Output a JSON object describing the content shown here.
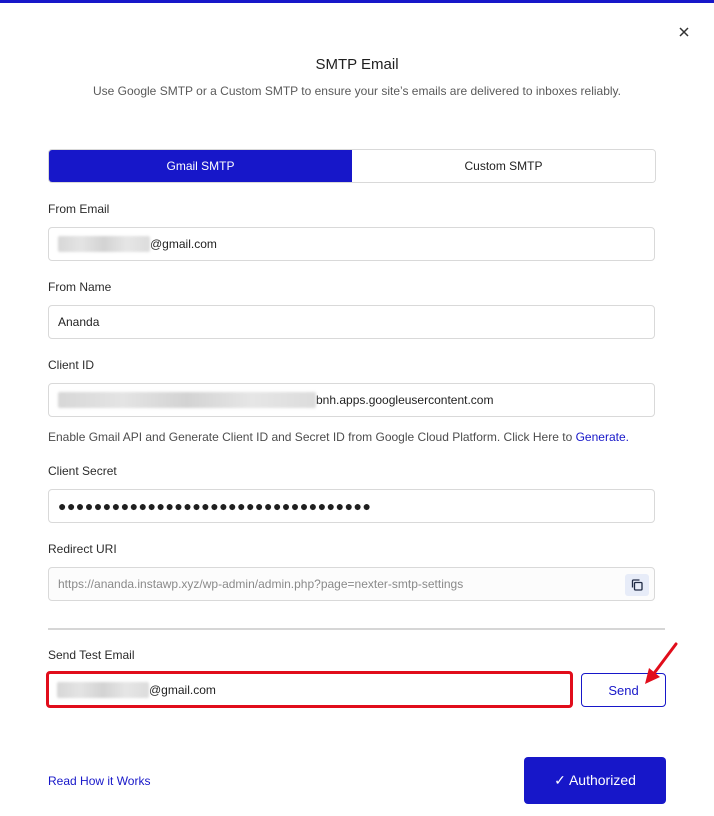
{
  "modal": {
    "title": "SMTP Email",
    "subtitle": "Use Google SMTP or a Custom SMTP to ensure your site’s emails are delivered to inboxes reliably.",
    "close_icon": "close-icon",
    "accent_color": "#1717c9"
  },
  "tabs": [
    {
      "label": "Gmail SMTP",
      "active": true
    },
    {
      "label": "Custom SMTP",
      "active": false
    }
  ],
  "form": {
    "from_email": {
      "label": "From Email",
      "value": "@gmail.com"
    },
    "from_name": {
      "label": "From Name",
      "value": "Ananda"
    },
    "client_id": {
      "label": "Client ID",
      "value": "bnh.apps.googleusercontent.com"
    },
    "help_text": "Enable Gmail API and Generate Client ID and Secret ID from Google Cloud Platform. Click Here to",
    "help_link": "Generate.",
    "client_secret": {
      "label": "Client Secret",
      "value": "●●●●●●●●●●●●●●●●●●●●●●●●●●●●●●●●●●●"
    },
    "redirect_uri": {
      "label": "Redirect URI",
      "value": "https://ananda.instawp.xyz/wp-admin/admin.php?page=nexter-smtp-settings",
      "copy_icon": "copy-icon"
    }
  },
  "test_email": {
    "label": "Send Test Email",
    "value": "@gmail.com",
    "send_label": "Send",
    "highlight_color": "#e10d1b"
  },
  "footer": {
    "read_link": "Read How it Works",
    "authorized_label": "✓ Authorized"
  }
}
